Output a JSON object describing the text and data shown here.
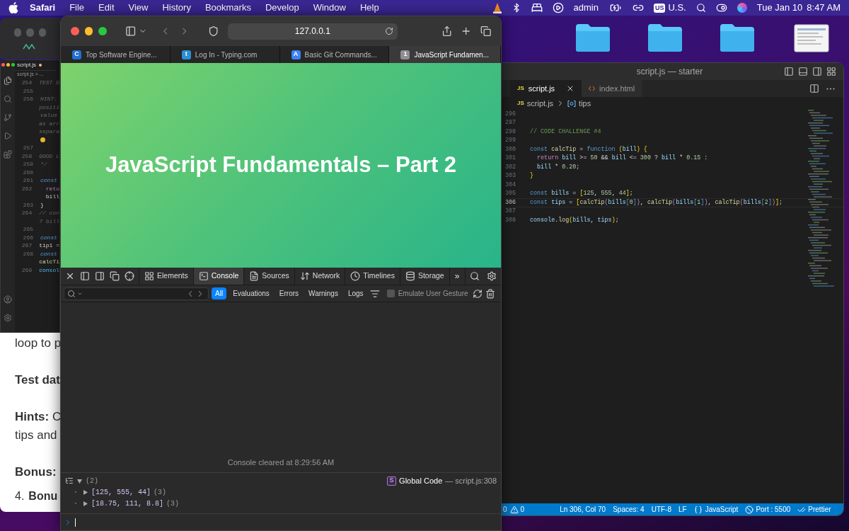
{
  "menubar": {
    "app": "Safari",
    "menus": [
      "File",
      "Edit",
      "View",
      "History",
      "Bookmarks",
      "Develop",
      "Window",
      "Help"
    ],
    "user": "admin",
    "input_badge": "US",
    "input_label": "U.S.",
    "date": "Tue Jan 10",
    "time": "8:47 AM"
  },
  "back_editor": {
    "tab": "script.js",
    "modified": true,
    "breadcrumb": "script.js > ...",
    "lines": [
      {
        "num": "254",
        "code": "TEST D",
        "kind": "comment"
      },
      {
        "num": "255"
      },
      {
        "num": "256",
        "code": "HINT:",
        "kind": "comment"
      },
      {
        "code": "positi",
        "kind": "comment"
      },
      {
        "code": "value",
        "kind": "comment"
      },
      {
        "code": "as arr",
        "kind": "comment"
      },
      {
        "code": "separa",
        "kind": "comment"
      },
      {
        "kind": "emoji"
      },
      {
        "num": "257"
      },
      {
        "num": "258",
        "code": "GOOD L",
        "kind": "comment"
      },
      {
        "num": "259",
        "code": "*/",
        "kind": "comment"
      },
      {
        "num": "260"
      },
      {
        "num": "261",
        "code": "const",
        "kind": "keyword"
      },
      {
        "num": "262",
        "code": "  retu",
        "kind": "control"
      },
      {
        "code": "  bill",
        "kind": "plain"
      },
      {
        "num": "263",
        "code": "}",
        "kind": "plain"
      },
      {
        "num": "264",
        "code": "// con",
        "kind": "comment"
      },
      {
        "code": "? bill",
        "kind": "comment"
      },
      {
        "num": "265"
      },
      {
        "num": "266",
        "code": "const",
        "kind": "keyword"
      },
      {
        "num": "267",
        "code": "tip1 =",
        "kind": "plain"
      },
      {
        "num": "268",
        "code": "const",
        "kind": "keyword"
      },
      {
        "code": "calcTi",
        "kind": "function"
      },
      {
        "num": "269",
        "code": "consol",
        "kind": "variable"
      }
    ]
  },
  "back_article": [
    {
      "kind": "text",
      "text": "loop to p"
    },
    {
      "kind": "heading",
      "text": "Test dat"
    },
    {
      "kind": "text",
      "text": "**Hints:** C"
    },
    {
      "kind": "text",
      "text": "tips and"
    },
    {
      "kind": "heading",
      "text": "Bonus:"
    },
    {
      "kind": "list",
      "marker": "4.",
      "text": "Bonu"
    }
  ],
  "safari": {
    "url": "127.0.0.1",
    "tabs": [
      {
        "label": "Top Software Engine...",
        "selected": false,
        "favicon": "C",
        "color": "#1f6fd1"
      },
      {
        "label": "Log In - Typing.com",
        "selected": false,
        "favicon": "t",
        "color": "#2b8fd6"
      },
      {
        "label": "Basic Git Commands...",
        "selected": false,
        "favicon": "A",
        "color": "#3b82f6"
      },
      {
        "label": "JavaScript Fundamen...",
        "selected": true,
        "favicon": "1",
        "color": "#8e8e93"
      }
    ],
    "page_heading": "JavaScript Fundamentals – Part 2",
    "devtools": {
      "tabs": [
        {
          "label": "Elements",
          "selected": false
        },
        {
          "label": "Console",
          "selected": true
        },
        {
          "label": "Sources",
          "selected": false
        },
        {
          "label": "Network",
          "selected": false
        },
        {
          "label": "Timelines",
          "selected": false
        },
        {
          "label": "Storage",
          "selected": false
        }
      ],
      "more": "»",
      "filters": [
        {
          "label": "All",
          "selected": true
        },
        {
          "label": "Evaluations",
          "selected": false
        },
        {
          "label": "Errors",
          "selected": false
        },
        {
          "label": "Warnings",
          "selected": false
        },
        {
          "label": "Logs",
          "selected": false
        }
      ],
      "emulate": {
        "label": "Emulate User Gesture",
        "checked": false
      },
      "cleared": "Console cleared at 8:29:56 AM",
      "log": {
        "count": "(2)",
        "expanded": true,
        "source_badge": "S",
        "source": "Global Code",
        "location": "— script.js:308",
        "items": [
          {
            "value": "[125, 555, 44]",
            "length": "(3)",
            "expanded": false
          },
          {
            "value": "[18.75, 111, 8.8]",
            "length": "(3)",
            "expanded": false
          }
        ]
      }
    }
  },
  "editor": {
    "title": "script.js — starter",
    "tabs": [
      {
        "label": "script.js",
        "kind": "js",
        "badge": "JS",
        "selected": true
      },
      {
        "label": "index.html",
        "kind": "html",
        "selected": false
      }
    ],
    "breadcrumb": {
      "badge": "JS",
      "file": "script.js",
      "symbol": "tips"
    },
    "lines": [
      {
        "num": "296",
        "current": false
      },
      {
        "num": "297",
        "current": false
      },
      {
        "num": "298",
        "current": false,
        "tokens": [
          {
            "text": "// CODE CHALLENGE #4",
            "kind": "comment"
          }
        ]
      },
      {
        "num": "299",
        "current": false
      },
      {
        "num": "300",
        "current": false,
        "tokens": [
          {
            "text": "const ",
            "kind": "keyword"
          },
          {
            "text": "calcTip",
            "kind": "function"
          },
          {
            "text": " = ",
            "kind": "plain"
          },
          {
            "text": "function ",
            "kind": "keyword"
          },
          {
            "text": "(",
            "kind": "bracket"
          },
          {
            "text": "bill",
            "kind": "variable"
          },
          {
            "text": ") {",
            "kind": "bracket"
          }
        ]
      },
      {
        "num": "301",
        "current": false,
        "tokens": [
          {
            "text": "  return ",
            "kind": "control"
          },
          {
            "text": "bill",
            "kind": "variable"
          },
          {
            "text": " >= ",
            "kind": "plain"
          },
          {
            "text": "50",
            "kind": "number"
          },
          {
            "text": " && ",
            "kind": "plain"
          },
          {
            "text": "bill",
            "kind": "variable"
          },
          {
            "text": " <= ",
            "kind": "plain"
          },
          {
            "text": "300",
            "kind": "number"
          },
          {
            "text": " ? ",
            "kind": "plain"
          },
          {
            "text": "bill",
            "kind": "variable"
          },
          {
            "text": " * ",
            "kind": "plain"
          },
          {
            "text": "0.15",
            "kind": "number"
          },
          {
            "text": " :",
            "kind": "plain"
          }
        ]
      },
      {
        "num": "302",
        "current": false,
        "tokens": [
          {
            "text": "  bill",
            "kind": "variable"
          },
          {
            "text": " * ",
            "kind": "plain"
          },
          {
            "text": "0.20",
            "kind": "number"
          },
          {
            "text": ";",
            "kind": "plain"
          }
        ]
      },
      {
        "num": "303",
        "current": false,
        "tokens": [
          {
            "text": "}",
            "kind": "bracket"
          }
        ]
      },
      {
        "num": "304",
        "current": false
      },
      {
        "num": "305",
        "current": false,
        "tokens": [
          {
            "text": "const ",
            "kind": "keyword"
          },
          {
            "text": "bills",
            "kind": "variable"
          },
          {
            "text": " = ",
            "kind": "plain"
          },
          {
            "text": "[",
            "kind": "bracket"
          },
          {
            "text": "125",
            "kind": "number"
          },
          {
            "text": ", ",
            "kind": "plain"
          },
          {
            "text": "555",
            "kind": "number"
          },
          {
            "text": ", ",
            "kind": "plain"
          },
          {
            "text": "44",
            "kind": "number"
          },
          {
            "text": "]",
            "kind": "bracket"
          },
          {
            "text": ";",
            "kind": "plain"
          }
        ]
      },
      {
        "num": "306",
        "current": true,
        "tokens": [
          {
            "text": "const ",
            "kind": "keyword"
          },
          {
            "text": "tips",
            "kind": "variable"
          },
          {
            "text": " = ",
            "kind": "plain"
          },
          {
            "text": "[",
            "kind": "bracket"
          },
          {
            "text": "calcTip",
            "kind": "function"
          },
          {
            "text": "(",
            "kind": "control"
          },
          {
            "text": "bills",
            "kind": "variable"
          },
          {
            "text": "[",
            "kind": "keyword"
          },
          {
            "text": "0",
            "kind": "number"
          },
          {
            "text": "]",
            "kind": "keyword"
          },
          {
            "text": ")",
            "kind": "control"
          },
          {
            "text": ", ",
            "kind": "plain"
          },
          {
            "text": "calcTip",
            "kind": "function"
          },
          {
            "text": "(",
            "kind": "control"
          },
          {
            "text": "bills",
            "kind": "variable"
          },
          {
            "text": "[",
            "kind": "keyword"
          },
          {
            "text": "1",
            "kind": "number"
          },
          {
            "text": "]",
            "kind": "keyword"
          },
          {
            "text": ")",
            "kind": "control"
          },
          {
            "text": ", ",
            "kind": "plain"
          },
          {
            "text": "calcTip",
            "kind": "function"
          },
          {
            "text": "(",
            "kind": "control"
          },
          {
            "text": "bills",
            "kind": "variable"
          },
          {
            "text": "[",
            "kind": "keyword"
          },
          {
            "text": "2",
            "kind": "number"
          },
          {
            "text": "]",
            "kind": "keyword"
          },
          {
            "text": ")",
            "kind": "control"
          },
          {
            "text": "]",
            "kind": "bracket"
          },
          {
            "text": ";",
            "kind": "plain"
          }
        ]
      },
      {
        "num": "307",
        "current": false
      },
      {
        "num": "308",
        "current": false,
        "tokens": [
          {
            "text": "console",
            "kind": "variable"
          },
          {
            "text": ".",
            "kind": "plain"
          },
          {
            "text": "log",
            "kind": "function"
          },
          {
            "text": "(",
            "kind": "bracket"
          },
          {
            "text": "bills",
            "kind": "variable"
          },
          {
            "text": ", ",
            "kind": "plain"
          },
          {
            "text": "tips",
            "kind": "variable"
          },
          {
            "text": ")",
            "kind": "bracket"
          },
          {
            "text": ";",
            "kind": "plain"
          }
        ]
      }
    ],
    "status": [
      {
        "kind": "count",
        "text": "0"
      },
      {
        "kind": "warnings",
        "text": "0"
      },
      {
        "kind": "plain",
        "text": "Ln 306, Col 70"
      },
      {
        "kind": "plain",
        "text": "Spaces: 4"
      },
      {
        "kind": "plain",
        "text": "UTF-8"
      },
      {
        "kind": "plain",
        "text": "LF"
      },
      {
        "kind": "language",
        "text": "JavaScript"
      },
      {
        "kind": "port",
        "text": "Port : 5500"
      },
      {
        "kind": "prettier",
        "text": "Prettier"
      }
    ]
  }
}
